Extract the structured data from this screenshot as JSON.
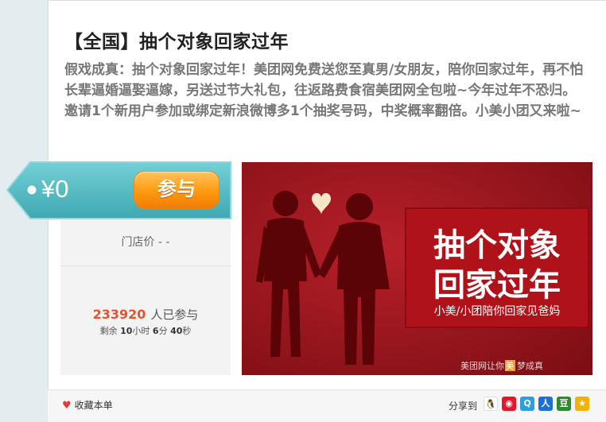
{
  "deal": {
    "title": "【全国】抽个对象回家过年",
    "description": "假戏成真：抽个对象回家过年！美团网免费送您至真男/女朋友，陪你回家过年，再不怕长辈逼婚逼娶逼嫁，另送过节大礼包，往返路费食宿美团网全包啦~今年过年不恐归。邀请1个新用户参加或绑定新浪微博多1个抽奖号码，中奖概率翻倍。小美小团又来啦~",
    "price": "¥0",
    "join_label": "参与",
    "store_price_label": "门店价 - -",
    "participants_count": "233920",
    "participants_label": "人已参与",
    "remain_prefix": "剩余",
    "remain_hours": "10",
    "remain_hours_unit": "小时",
    "remain_minutes": "6",
    "remain_minutes_unit": "分",
    "remain_seconds": "40",
    "remain_seconds_unit": "秒"
  },
  "banner": {
    "headline_line1": "抽个对象",
    "headline_line2": "回家过年",
    "subline": "小美/小团陪你回家见爸妈",
    "slogan_prefix": "美团网让你",
    "slogan_highlight": "美",
    "slogan_suffix": "梦成真"
  },
  "footer": {
    "favorite_label": "收藏本单",
    "share_label": "分享到",
    "share_icons": [
      "qq-icon",
      "weibo-icon",
      "qzone-icon",
      "renren-icon",
      "douban-icon",
      "kaixin-icon"
    ]
  },
  "colors": {
    "tag_teal": "#5bbfc6",
    "join_orange": "#ff9a10",
    "count_red": "#e8522c",
    "banner_red": "#a0141a"
  }
}
